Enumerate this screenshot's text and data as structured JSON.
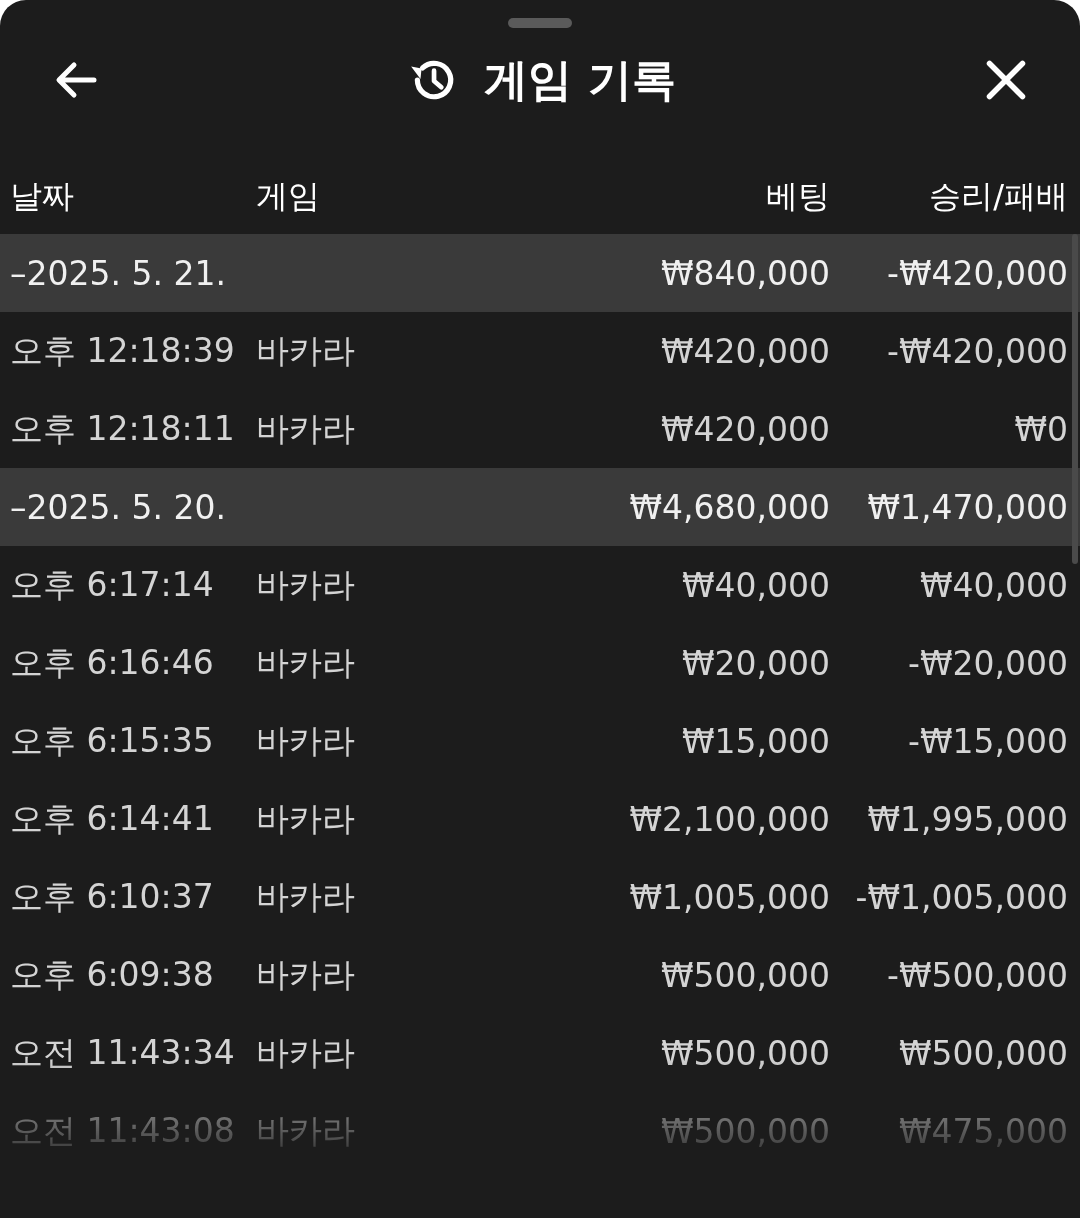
{
  "header": {
    "title": "게임 기록"
  },
  "columns": [
    "날짜",
    "게임",
    "베팅",
    "승리/패배"
  ],
  "groups": [
    {
      "date": "–2025. 5. 21.",
      "bet": "₩840,000",
      "result": "-₩420,000",
      "rows": [
        {
          "time": "오후 12:18:39",
          "game": "바카라",
          "bet": "₩420,000",
          "result": "-₩420,000"
        },
        {
          "time": "오후 12:18:11",
          "game": "바카라",
          "bet": "₩420,000",
          "result": "₩0"
        }
      ]
    },
    {
      "date": "–2025. 5. 20.",
      "bet": "₩4,680,000",
      "result": "₩1,470,000",
      "rows": [
        {
          "time": "오후 6:17:14",
          "game": "바카라",
          "bet": "₩40,000",
          "result": "₩40,000"
        },
        {
          "time": "오후 6:16:46",
          "game": "바카라",
          "bet": "₩20,000",
          "result": "-₩20,000"
        },
        {
          "time": "오후 6:15:35",
          "game": "바카라",
          "bet": "₩15,000",
          "result": "-₩15,000"
        },
        {
          "time": "오후 6:14:41",
          "game": "바카라",
          "bet": "₩2,100,000",
          "result": "₩1,995,000"
        },
        {
          "time": "오후 6:10:37",
          "game": "바카라",
          "bet": "₩1,005,000",
          "result": "-₩1,005,000"
        },
        {
          "time": "오후 6:09:38",
          "game": "바카라",
          "bet": "₩500,000",
          "result": "-₩500,000"
        },
        {
          "time": "오전 11:43:34",
          "game": "바카라",
          "bet": "₩500,000",
          "result": "₩500,000"
        },
        {
          "time": "오전 11:43:08",
          "game": "바카라",
          "bet": "₩500,000",
          "result": "₩475,000"
        }
      ]
    }
  ]
}
